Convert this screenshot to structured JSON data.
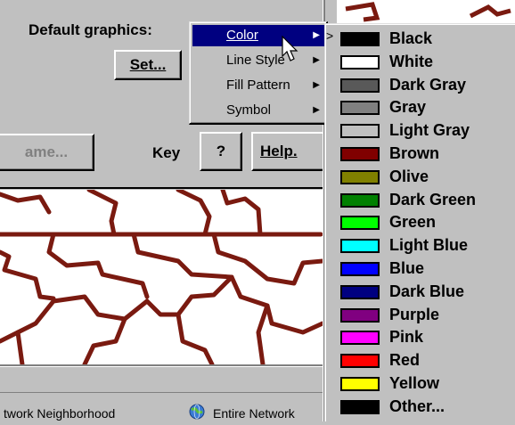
{
  "dialog": {
    "default_graphics_label": "Default graphics:",
    "set_button": "Set...",
    "name_button": "ame...",
    "key_label": "Key",
    "question_button": "?",
    "help_button": "Help."
  },
  "status_bar": {
    "items": [
      {
        "label": "twork Neighborhood",
        "icon": "network-neighborhood-icon"
      },
      {
        "label": "Entire Network",
        "icon": "globe-icon"
      }
    ]
  },
  "menu": {
    "items": [
      {
        "label": "Color",
        "accel": "C",
        "selected": true
      },
      {
        "label": "Line Style",
        "accel": "S",
        "selected": false
      },
      {
        "label": "Fill Pattern",
        "accel": "F",
        "selected": false
      },
      {
        "label": "Symbol",
        "accel": "",
        "selected": false
      }
    ]
  },
  "color_menu": {
    "items": [
      {
        "label": "Black",
        "color": "#000000"
      },
      {
        "label": "White",
        "color": "#ffffff"
      },
      {
        "label": "Dark Gray",
        "color": "#595959"
      },
      {
        "label": "Gray",
        "color": "#808080"
      },
      {
        "label": "Light Gray",
        "color": "#c0c0c0"
      },
      {
        "label": "Brown",
        "color": "#800000"
      },
      {
        "label": "Olive",
        "color": "#808000"
      },
      {
        "label": "Dark Green",
        "color": "#008000"
      },
      {
        "label": "Green",
        "color": "#00ff00"
      },
      {
        "label": "Light Blue",
        "color": "#00ffff"
      },
      {
        "label": "Blue",
        "color": "#0000ff"
      },
      {
        "label": "Dark Blue",
        "color": "#000080"
      },
      {
        "label": "Purple",
        "color": "#800080"
      },
      {
        "label": "Pink",
        "color": "#ff00ff"
      },
      {
        "label": "Red",
        "color": "#ff0000"
      },
      {
        "label": "Yellow",
        "color": "#ffff00"
      },
      {
        "label": "Other...",
        "color": "#000000"
      }
    ]
  },
  "colors": {
    "menu_highlight": "#000080",
    "map_border": "#7a1a10",
    "face": "#c0c0c0"
  }
}
